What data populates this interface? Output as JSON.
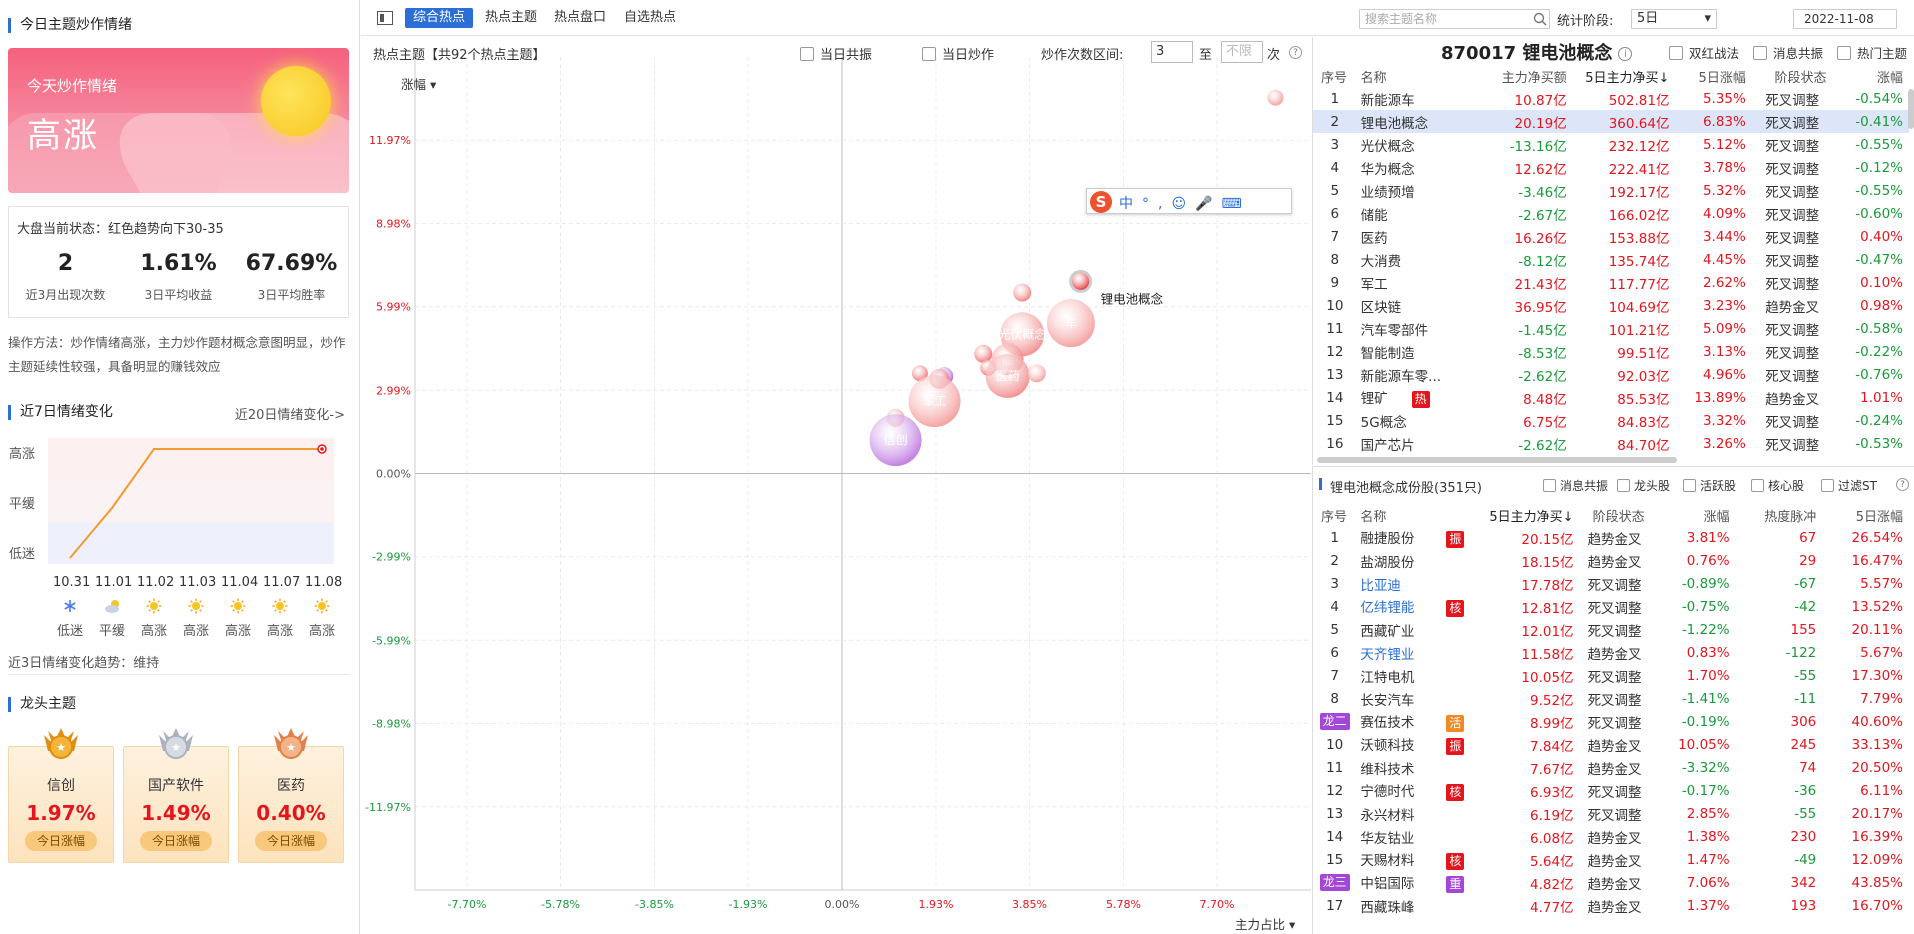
{
  "left": {
    "title": "今日主题炒作情绪",
    "banner": {
      "line1": "今天炒作情绪",
      "line2": "高涨"
    },
    "market_status": "大盘当前状态：红色趋势向下30-35",
    "stats": [
      {
        "value": "2",
        "label": "近3月出现次数"
      },
      {
        "value": "1.61%",
        "label": "3日平均收益"
      },
      {
        "value": "67.69%",
        "label": "3日平均胜率"
      }
    ],
    "method": "操作方法：炒作情绪高涨，主力炒作题材概念意图明显，炒作主题延续性较强，具备明显的赚钱效应",
    "sec7_title": "近7日情绪变化",
    "link20": "近20日情绪变化->",
    "levels": [
      "高涨",
      "平缓",
      "低迷"
    ],
    "days": [
      {
        "date": "10.31",
        "icon": "snowflake-icon",
        "mood": "低迷",
        "level": 0
      },
      {
        "date": "11.01",
        "icon": "cloud-sun-icon",
        "mood": "平缓",
        "level": 1
      },
      {
        "date": "11.02",
        "icon": "sun-icon",
        "mood": "高涨",
        "level": 2
      },
      {
        "date": "11.03",
        "icon": "sun-icon",
        "mood": "高涨",
        "level": 2
      },
      {
        "date": "11.04",
        "icon": "sun-icon",
        "mood": "高涨",
        "level": 2
      },
      {
        "date": "11.07",
        "icon": "sun-icon",
        "mood": "高涨",
        "level": 2
      },
      {
        "date": "11.08",
        "icon": "sun-icon",
        "mood": "高涨",
        "level": 2
      }
    ],
    "trend3": "近3日情绪变化趋势：维持",
    "lead_title": "龙头主题",
    "leaders": [
      {
        "name": "信创",
        "pct": "1.97%",
        "btn": "今日涨幅",
        "medal": "gold-medal-icon"
      },
      {
        "name": "国产软件",
        "pct": "1.49%",
        "btn": "今日涨幅",
        "medal": "silver-medal-icon"
      },
      {
        "name": "医药",
        "pct": "0.40%",
        "btn": "今日涨幅",
        "medal": "bronze-medal-icon"
      }
    ]
  },
  "toolbar": {
    "tabs": [
      "综合热点",
      "热点主题",
      "热点盘口",
      "自选热点"
    ],
    "search_placeholder": "搜索主题名称",
    "period_label": "统计阶段:",
    "period_value": "5日",
    "date": "2022-11-08"
  },
  "center": {
    "header": "热点主题【共92个热点主题】",
    "resonance": "当日共振",
    "hype": "当日炒作",
    "range_label": "炒作次数区间:",
    "range_from": "3",
    "to": "至",
    "range_to_placeholder": "不限",
    "unit": "次",
    "y_menu": "涨幅",
    "x_menu": "主力占比"
  },
  "chart_data": {
    "type": "scatter",
    "xlabel": "主力占比",
    "ylabel": "涨幅",
    "x_ticks": [
      "-7.70%",
      "-5.78%",
      "-3.85%",
      "-1.93%",
      "0.00%",
      "1.93%",
      "3.85%",
      "5.78%",
      "7.70%"
    ],
    "y_ticks": [
      "11.97%",
      "8.98%",
      "5.99%",
      "2.99%",
      "0.00%",
      "-2.99%",
      "-5.99%",
      "-8.98%",
      "-11.97%"
    ],
    "xlim": [
      -9.63,
      9.63
    ],
    "ylim": [
      -14.96,
      14.96
    ],
    "points": [
      {
        "label": "",
        "x": 8.9,
        "y": 13.5,
        "size": 8,
        "color": "#f49a9a"
      },
      {
        "label": "锂电池概念",
        "x": 4.9,
        "y": 6.9,
        "size": 10,
        "color": "#e4151d",
        "callout": true
      },
      {
        "label": "",
        "x": 3.7,
        "y": 6.5,
        "size": 9,
        "color": "#f08080"
      },
      {
        "label": "车",
        "x": 4.7,
        "y": 5.4,
        "size": 24,
        "color": "#f4a0a0"
      },
      {
        "label": "光伏概念",
        "x": 3.7,
        "y": 5.0,
        "size": 22,
        "color": "#f29090"
      },
      {
        "label": "能",
        "x": 3.4,
        "y": 4.1,
        "size": 16,
        "color": "#f08080"
      },
      {
        "label": "",
        "x": 2.9,
        "y": 4.3,
        "size": 9,
        "color": "#f07070"
      },
      {
        "label": "",
        "x": 3.0,
        "y": 3.8,
        "size": 8,
        "color": "#f07070"
      },
      {
        "label": "医药",
        "x": 3.4,
        "y": 3.5,
        "size": 22,
        "color": "#f29090"
      },
      {
        "label": "",
        "x": 4.0,
        "y": 3.6,
        "size": 9,
        "color": "#f4a0a0"
      },
      {
        "label": "",
        "x": 2.1,
        "y": 3.5,
        "size": 9,
        "color": "#b36de0"
      },
      {
        "label": "",
        "x": 1.6,
        "y": 3.6,
        "size": 8,
        "color": "#f07070"
      },
      {
        "label": "",
        "x": 2.0,
        "y": 3.4,
        "size": 10,
        "color": "#f07070"
      },
      {
        "label": "军工",
        "x": 1.9,
        "y": 2.6,
        "size": 26,
        "color": "#f4a0a0"
      },
      {
        "label": "",
        "x": 1.1,
        "y": 2.0,
        "size": 9,
        "color": "#f49a9a"
      },
      {
        "label": "信创",
        "x": 1.1,
        "y": 1.2,
        "size": 26,
        "color": "#c07ee0"
      }
    ]
  },
  "themes": {
    "code_name": "870017 锂电池概念",
    "checks": [
      "双红战法",
      "消息共振",
      "热门主题"
    ],
    "columns": [
      "序号",
      "名称",
      "主力净买额",
      "5日主力净买↓",
      "5日涨幅",
      "阶段状态",
      "涨幅"
    ],
    "rows": [
      [
        "1",
        "新能源车",
        "10.87亿",
        "502.81亿",
        "5.35%",
        "死叉调整",
        "-0.54%",
        ""
      ],
      [
        "2",
        "锂电池概念",
        "20.19亿",
        "360.64亿",
        "6.83%",
        "死叉调整",
        "-0.41%",
        ""
      ],
      [
        "3",
        "光伏概念",
        "-13.16亿",
        "232.12亿",
        "5.12%",
        "死叉调整",
        "-0.55%",
        ""
      ],
      [
        "4",
        "华为概念",
        "12.62亿",
        "222.41亿",
        "3.78%",
        "死叉调整",
        "-0.12%",
        ""
      ],
      [
        "5",
        "业绩预增",
        "-3.46亿",
        "192.17亿",
        "5.32%",
        "死叉调整",
        "-0.55%",
        ""
      ],
      [
        "6",
        "储能",
        "-2.67亿",
        "166.02亿",
        "4.09%",
        "死叉调整",
        "-0.60%",
        ""
      ],
      [
        "7",
        "医药",
        "16.26亿",
        "153.88亿",
        "3.44%",
        "死叉调整",
        "0.40%",
        ""
      ],
      [
        "8",
        "大消费",
        "-8.12亿",
        "135.74亿",
        "4.45%",
        "死叉调整",
        "-0.47%",
        ""
      ],
      [
        "9",
        "军工",
        "21.43亿",
        "117.77亿",
        "2.62%",
        "死叉调整",
        "0.10%",
        ""
      ],
      [
        "10",
        "区块链",
        "36.95亿",
        "104.69亿",
        "3.23%",
        "趋势金叉",
        "0.98%",
        ""
      ],
      [
        "11",
        "汽车零部件",
        "-1.45亿",
        "101.21亿",
        "5.09%",
        "死叉调整",
        "-0.58%",
        ""
      ],
      [
        "12",
        "智能制造",
        "-8.53亿",
        "99.51亿",
        "3.13%",
        "死叉调整",
        "-0.22%",
        ""
      ],
      [
        "13",
        "新能源车零...",
        "-2.62亿",
        "92.03亿",
        "4.96%",
        "死叉调整",
        "-0.76%",
        ""
      ],
      [
        "14",
        "锂矿",
        "8.48亿",
        "85.53亿",
        "13.89%",
        "趋势金叉",
        "1.01%",
        "热"
      ],
      [
        "15",
        "5G概念",
        "6.75亿",
        "84.83亿",
        "3.32%",
        "死叉调整",
        "-0.24%",
        ""
      ],
      [
        "16",
        "国产芯片",
        "-2.62亿",
        "84.70亿",
        "3.26%",
        "死叉调整",
        "-0.53%",
        ""
      ]
    ]
  },
  "stocks": {
    "title": "锂电池概念成份股(351只)",
    "checks": [
      "消息共振",
      "龙头股",
      "活跃股",
      "核心股",
      "过滤ST"
    ],
    "columns": [
      "序号",
      "名称",
      "5日主力净买↓",
      "阶段状态",
      "涨幅",
      "热度脉冲",
      "5日涨幅"
    ],
    "rows": [
      [
        "1",
        "融捷股份",
        "振",
        "20.15亿",
        "趋势金叉",
        "3.81%",
        "67",
        "26.54%",
        ""
      ],
      [
        "2",
        "盐湖股份",
        "",
        "18.15亿",
        "趋势金叉",
        "0.76%",
        "29",
        "16.47%",
        ""
      ],
      [
        "3",
        "比亚迪",
        "",
        "17.78亿",
        "死叉调整",
        "-0.89%",
        "-67",
        "5.57%",
        ""
      ],
      [
        "4",
        "亿纬锂能",
        "核",
        "12.81亿",
        "死叉调整",
        "-0.75%",
        "-42",
        "13.52%",
        ""
      ],
      [
        "5",
        "西藏矿业",
        "",
        "12.01亿",
        "死叉调整",
        "-1.22%",
        "155",
        "20.11%",
        ""
      ],
      [
        "6",
        "天齐锂业",
        "",
        "11.58亿",
        "趋势金叉",
        "0.83%",
        "-122",
        "5.67%",
        ""
      ],
      [
        "7",
        "江特电机",
        "",
        "10.05亿",
        "死叉调整",
        "1.70%",
        "-55",
        "17.30%",
        ""
      ],
      [
        "8",
        "长安汽车",
        "",
        "9.52亿",
        "死叉调整",
        "-1.41%",
        "-11",
        "7.79%",
        ""
      ],
      [
        "9",
        "赛伍技术",
        "活",
        "8.99亿",
        "死叉调整",
        "-0.19%",
        "306",
        "40.60%",
        "龙二"
      ],
      [
        "10",
        "沃顿科技",
        "振",
        "7.84亿",
        "趋势金叉",
        "10.05%",
        "245",
        "33.13%",
        ""
      ],
      [
        "11",
        "维科技术",
        "",
        "7.67亿",
        "趋势金叉",
        "-3.32%",
        "74",
        "20.50%",
        ""
      ],
      [
        "12",
        "宁德时代",
        "核",
        "6.93亿",
        "死叉调整",
        "-0.17%",
        "-36",
        "6.11%",
        ""
      ],
      [
        "13",
        "永兴材料",
        "",
        "6.19亿",
        "死叉调整",
        "2.85%",
        "-55",
        "20.17%",
        ""
      ],
      [
        "14",
        "华友钴业",
        "",
        "6.08亿",
        "趋势金叉",
        "1.38%",
        "230",
        "16.39%",
        ""
      ],
      [
        "15",
        "天赐材料",
        "核",
        "5.64亿",
        "趋势金叉",
        "1.47%",
        "-49",
        "12.09%",
        ""
      ],
      [
        "16",
        "中铝国际",
        "重",
        "4.82亿",
        "趋势金叉",
        "7.06%",
        "342",
        "43.85%",
        "龙三"
      ],
      [
        "17",
        "西藏珠峰",
        "",
        "4.77亿",
        "趋势金叉",
        "1.37%",
        "193",
        "16.70%",
        ""
      ]
    ]
  },
  "ime_toolbar": {
    "items": [
      "中",
      "°,",
      "☺",
      "🎤",
      "⌨"
    ]
  }
}
